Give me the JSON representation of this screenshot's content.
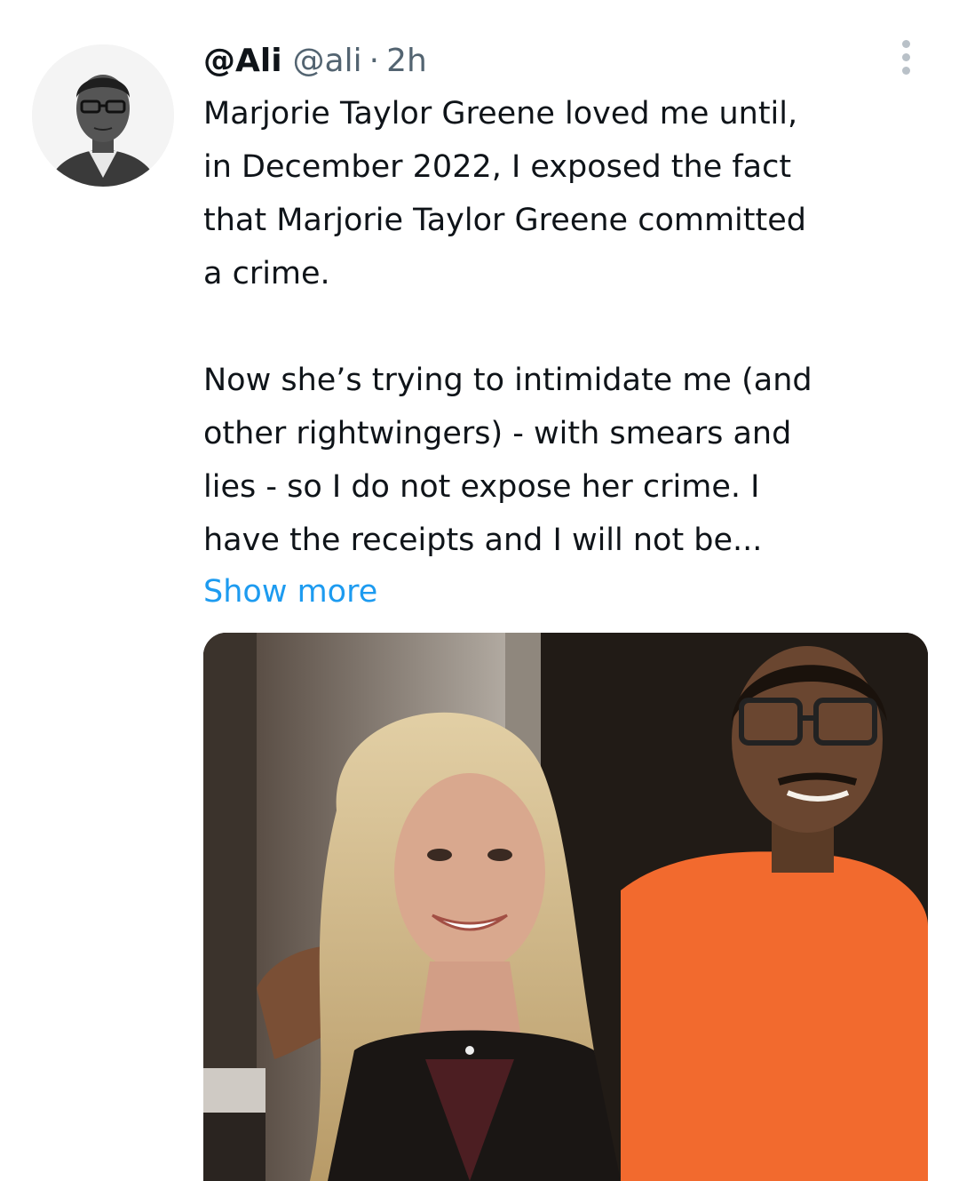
{
  "tweet": {
    "display_name": "@Ali",
    "handle": "@ali",
    "separator": "·",
    "time": "2h",
    "text_lines": [
      "Marjorie Taylor Greene loved me until,",
      "in December 2022, I exposed the fact",
      "that Marjorie Taylor Greene committed",
      "a crime."
    ],
    "text_lines_2": [
      "Now she’s trying to intimidate me (and",
      "other rightwingers) - with smears and",
      "lies - so I do not expose her crime. I",
      "have the receipts and I will not be..."
    ],
    "show_more": "Show more"
  },
  "icons": {
    "more": "more-vertical-icon"
  },
  "colors": {
    "text": "#0f1419",
    "secondary": "#536471",
    "link": "#1d9bf0"
  }
}
